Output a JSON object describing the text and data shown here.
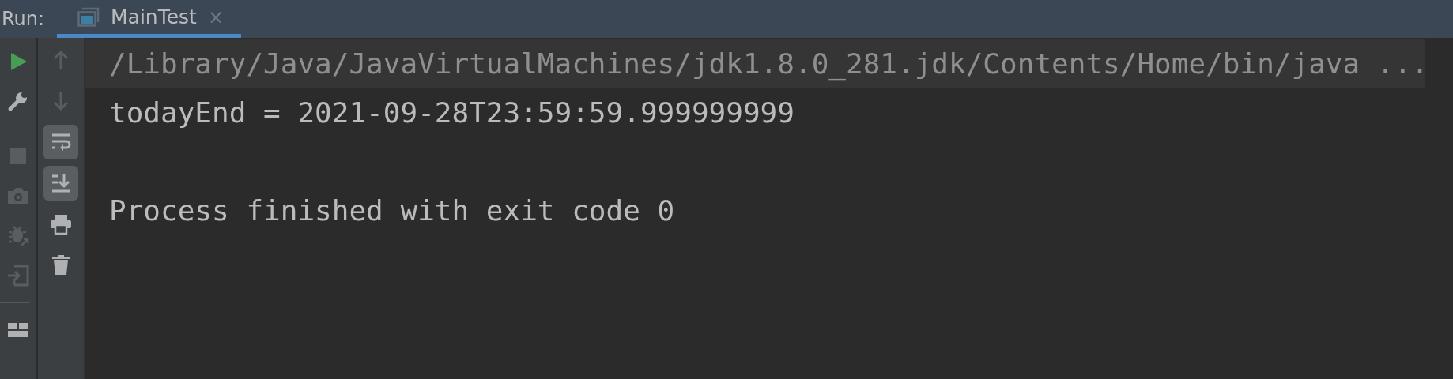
{
  "header": {
    "label": "Run:",
    "tabs": [
      {
        "label": "MainTest",
        "selected": true,
        "close": "×"
      }
    ]
  },
  "run_toolbar": [
    [
      {
        "disabled": false
      },
      {
        "disabled": false
      }
    ],
    [
      {
        "disabled": true
      },
      {
        "disabled": true
      },
      {
        "disabled": true
      },
      {
        "disabled": true
      }
    ],
    [
      {
        "disabled": false
      }
    ]
  ],
  "console_toolbar": [
    {
      "kind": "action",
      "disabled": true
    },
    {
      "kind": "action",
      "disabled": true
    },
    {
      "kind": "toggle",
      "on": true
    },
    {
      "kind": "toggle",
      "on": true
    },
    {
      "kind": "action",
      "disabled": false
    },
    {
      "kind": "action",
      "disabled": false
    }
  ],
  "console": [
    {
      "kind": "command",
      "text": "/Library/Java/JavaVirtualMachines/jdk1.8.0_281.jdk/Contents/Home/bin/java ..."
    },
    {
      "kind": "output",
      "text": "todayEnd = 2021-09-28T23:59:59.999999999"
    },
    {
      "kind": "blank"
    },
    {
      "kind": "output",
      "text": "Process finished with exit code 0"
    }
  ]
}
